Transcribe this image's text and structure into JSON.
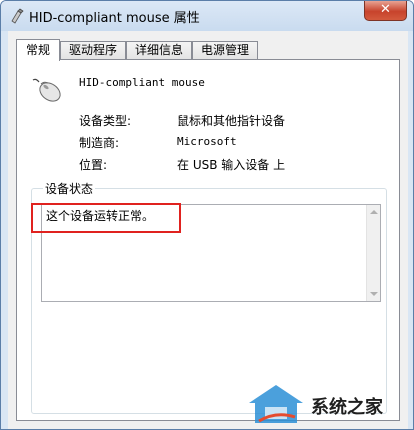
{
  "window": {
    "title": "HID-compliant mouse 属性",
    "close_label": "✕"
  },
  "tabs": [
    {
      "label": "常规",
      "active": true
    },
    {
      "label": "驱动程序",
      "active": false
    },
    {
      "label": "详细信息",
      "active": false
    },
    {
      "label": "电源管理",
      "active": false
    }
  ],
  "device": {
    "name": "HID-compliant mouse",
    "icon": "mouse-icon"
  },
  "properties": [
    {
      "label": "设备类型:",
      "value": "鼠标和其他指针设备"
    },
    {
      "label": "制造商:",
      "value": "Microsoft"
    },
    {
      "label": "位置:",
      "value": "在 USB 输入设备 上"
    }
  ],
  "status_group": {
    "title": "设备状态",
    "text": "这个设备运转正常。"
  },
  "watermark": {
    "text": "系统之家"
  },
  "colors": {
    "highlight": "#e0221f",
    "title_bar": "#d9e6f4"
  }
}
